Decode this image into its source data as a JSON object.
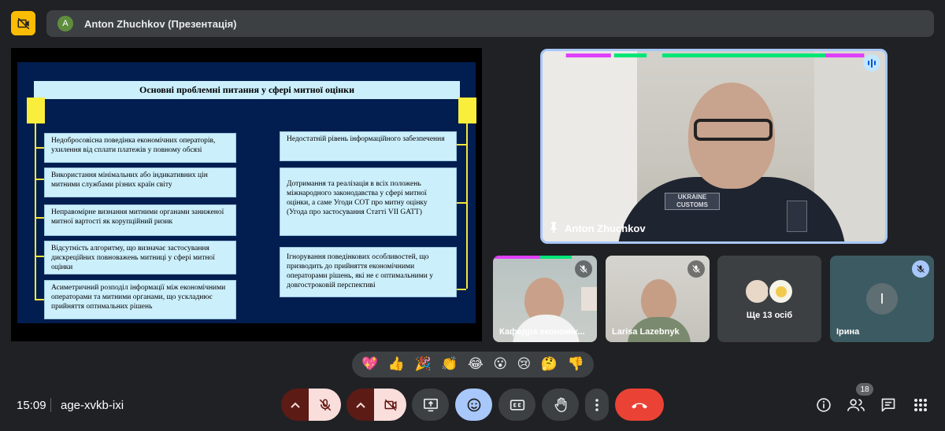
{
  "presentation_bar": {
    "avatar_letter": "A",
    "title": "Anton Zhuchkov (Презентація)"
  },
  "slide": {
    "title": "Основні проблемні питання у сфері митної оцінки",
    "left_items": [
      "Недобросовісна поведінка економічних операторів, ухилення від сплати платежів у повному обсязі",
      "Використання мінімальних або індикативних цін митними службами різних країн світу",
      "Неправомірне визнання митними органами заниженої митної вартості як корупційний ризик",
      "Відсутність алгоритму, що визначає застосування дискреційних повноважень митниці у сфері митної оцінки",
      "Асиметричний розподіл інформації між економічними операторами та митними органами, що ускладнює прийняття оптимальних рішень"
    ],
    "right_items": [
      "Недостатній рівень інформаційного забезпечення",
      "Дотримання та реалізація в всіх положень міжнародного законодавства у сфері митної оцінки, а саме Угоди СОТ про митну оцінку (Угода про застосування Статті VII GATT)",
      "Ігнорування поведінкових особливостей, що призводить до прийняття економічними операторами рішень, які не є оптимальними у довгостроковій перспективі"
    ]
  },
  "speaker": {
    "name": "Anton Zhuchkov",
    "patch_text": "UKRAINE",
    "patch_subtext": "CUSTOMS"
  },
  "tiles": [
    {
      "name": "Кафедра економік...",
      "muted": true
    },
    {
      "name": "Larisa Lazebnyk",
      "muted": true
    },
    {
      "name": "Ще 13 осіб",
      "muted": false
    },
    {
      "name": "Ірина",
      "avatar_letter": "І",
      "muted": true
    }
  ],
  "reactions": [
    "💖",
    "👍",
    "🎉",
    "👏",
    "😂",
    "😮",
    "😢",
    "🤔",
    "👎"
  ],
  "footer": {
    "time": "15:09",
    "meeting_code": "age-xvkb-ixi",
    "participants_count": "18"
  },
  "colors": {
    "accent_blue": "#a8c7fa",
    "hangup_red": "#ea4335",
    "warning_yellow": "#fbbc04",
    "slide_bg": "#021d4f",
    "slide_box": "#cceffc",
    "slide_yellow": "#f9ee3b"
  }
}
